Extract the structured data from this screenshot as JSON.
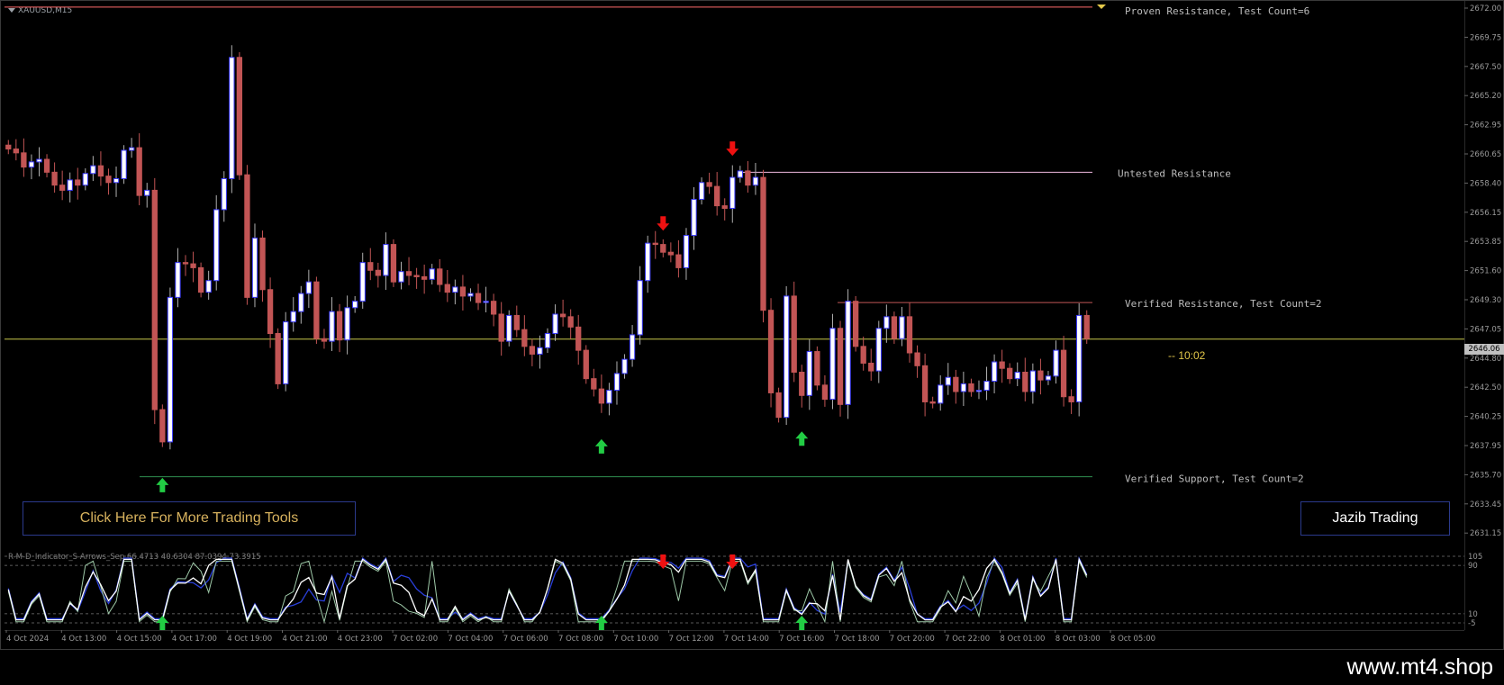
{
  "symbol_label": "XAUUSD,M15",
  "indicator_label": "R-M-D_Indicator_S-Arrows_Sep 66.4713 40.6304 87.0394 73.3915",
  "buttons": {
    "more_tools": "Click Here For More Trading Tools",
    "brand": "Jazib Trading"
  },
  "footer_url": "www.mt4.shop",
  "countdown": "10:02",
  "current_price": "2646.06",
  "zones": [
    {
      "label": "Proven Resistance, Test Count=6",
      "price": 2671.8,
      "color": "#ff6b6b"
    },
    {
      "label": "Untested Resistance",
      "price": 2659.0,
      "color": "#f0b9e0"
    },
    {
      "label": "Verified Resistance, Test Count=2",
      "price": 2648.9,
      "color": "#c05555"
    },
    {
      "label": "Verified Support, Test Count=2",
      "price": 2635.4,
      "color": "#2f8f4f"
    }
  ],
  "price_axis": {
    "min": 2630.0,
    "max": 2672.0,
    "ticks": [
      "2672.00",
      "2669.75",
      "2667.50",
      "2665.20",
      "2662.95",
      "2660.65",
      "2658.40",
      "2656.15",
      "2653.85",
      "2651.60",
      "2649.30",
      "2647.05",
      "2644.80",
      "2642.50",
      "2640.25",
      "2637.95",
      "2635.70",
      "2633.45",
      "2631.15"
    ]
  },
  "sub_axis": {
    "ticks": [
      "105",
      "90",
      "10",
      "-5"
    ],
    "levels": [
      105,
      90,
      10,
      -5
    ]
  },
  "time_axis": [
    "4 Oct 2024",
    "4 Oct 13:00",
    "4 Oct 15:00",
    "4 Oct 17:00",
    "4 Oct 19:00",
    "4 Oct 21:00",
    "4 Oct 23:00",
    "7 Oct 02:00",
    "7 Oct 04:00",
    "7 Oct 06:00",
    "7 Oct 08:00",
    "7 Oct 10:00",
    "7 Oct 12:00",
    "7 Oct 14:00",
    "7 Oct 16:00",
    "7 Oct 18:00",
    "7 Oct 20:00",
    "7 Oct 22:00",
    "8 Oct 01:00",
    "8 Oct 03:00",
    "8 Oct 05:00"
  ],
  "colors": {
    "bull": "#3b3bff",
    "bear": "#c25555",
    "bull_body": "#ffffff",
    "bear_body": "#c25555",
    "wick": "#b0b0b0",
    "buy_arrow": "#22cc44",
    "sell_arrow": "#ee1111",
    "price_line": "#c8c84a"
  },
  "chart_data": {
    "type": "candlestick",
    "symbol": "XAUUSD",
    "timeframe": "M15",
    "price_range": [
      2630.0,
      2672.0
    ],
    "close_prices": [
      2660.8,
      2660.5,
      2659.4,
      2659.8,
      2660.0,
      2659.0,
      2658.0,
      2657.6,
      2658.4,
      2658.0,
      2658.9,
      2659.5,
      2658.7,
      2658.2,
      2658.5,
      2660.7,
      2660.9,
      2657.2,
      2657.6,
      2640.6,
      2638.1,
      2649.3,
      2652.0,
      2651.9,
      2651.6,
      2649.7,
      2650.6,
      2656.1,
      2658.5,
      2667.9,
      2658.8,
      2649.3,
      2653.9,
      2649.9,
      2646.5,
      2642.6,
      2647.4,
      2648.2,
      2649.6,
      2650.5,
      2646.1,
      2645.9,
      2648.2,
      2646.0,
      2648.5,
      2649.0,
      2652.0,
      2651.4,
      2651.0,
      2653.4,
      2650.5,
      2651.3,
      2651.0,
      2650.9,
      2650.7,
      2651.5,
      2650.3,
      2649.7,
      2650.1,
      2649.4,
      2649.6,
      2648.9,
      2649.0,
      2648.0,
      2645.9,
      2647.9,
      2646.8,
      2645.5,
      2644.9,
      2645.4,
      2646.5,
      2648.0,
      2647.8,
      2647.0,
      2645.2,
      2643.0,
      2642.2,
      2641.1,
      2642.1,
      2643.4,
      2644.5,
      2646.4,
      2650.6,
      2653.5,
      2653.4,
      2652.8,
      2652.6,
      2651.6,
      2654.1,
      2656.9,
      2658.2,
      2657.9,
      2656.4,
      2656.2,
      2658.6,
      2659.1,
      2658.0,
      2658.6,
      2648.3,
      2641.9,
      2640.0,
      2649.4,
      2643.5,
      2641.7,
      2645.1,
      2642.5,
      2641.4,
      2646.9,
      2641.0,
      2649.0,
      2645.5,
      2644.2,
      2643.6,
      2646.9,
      2647.8,
      2646.1,
      2647.8,
      2645.0,
      2644.0,
      2641.2,
      2641.1,
      2642.5,
      2643.1,
      2642.0,
      2642.6,
      2642.0,
      2642.1,
      2642.8,
      2644.3,
      2643.8,
      2643.0,
      2643.5,
      2642.0,
      2643.6,
      2642.9,
      2643.2,
      2645.2,
      2641.6,
      2641.2,
      2647.9,
      2646.1
    ],
    "signals": [
      {
        "type": "buy",
        "bar": 20
      },
      {
        "type": "buy",
        "bar": 77
      },
      {
        "type": "sell",
        "bar": 85
      },
      {
        "type": "sell",
        "bar": 94
      },
      {
        "type": "buy",
        "bar": 103
      }
    ]
  }
}
